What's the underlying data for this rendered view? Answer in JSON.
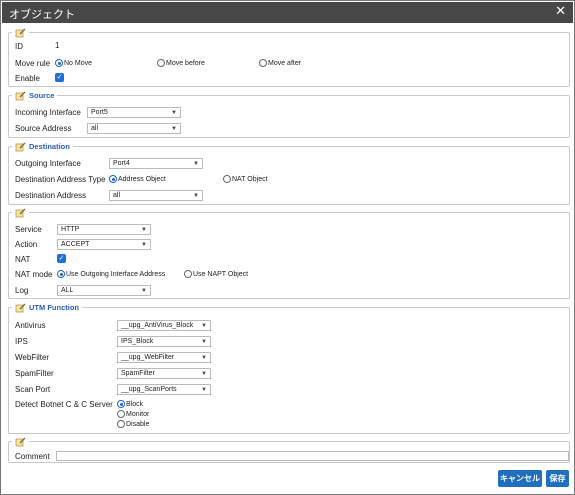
{
  "window": {
    "title": "オブジェクト",
    "close_glyph": "✕"
  },
  "general": {
    "id_label": "ID",
    "id_value": "1",
    "move_rule_label": "Move rule",
    "move_options": [
      "No Move",
      "Move before",
      "Move after"
    ],
    "move_selected": "No Move",
    "enable_label": "Enable",
    "enable_checked": true
  },
  "source": {
    "title": "Source",
    "incoming_interface_label": "Incoming Interface",
    "incoming_interface_value": "Port5",
    "source_address_label": "Source Address",
    "source_address_value": "all"
  },
  "destination": {
    "title": "Destination",
    "outgoing_interface_label": "Outgoing Interface",
    "outgoing_interface_value": "Port4",
    "dest_type_label": "Destination Address Type",
    "dest_type_options": [
      "Address Object",
      "NAT Object"
    ],
    "dest_type_selected": "Address Object",
    "dest_address_label": "Destination Address",
    "dest_address_value": "all"
  },
  "service": {
    "service_label": "Service",
    "service_value": "HTTP",
    "action_label": "Action",
    "action_value": "ACCEPT",
    "nat_label": "NAT",
    "nat_checked": true,
    "nat_mode_label": "NAT mode",
    "nat_mode_options": [
      "Use Outgoing Interface Address",
      "Use NAPT Object"
    ],
    "nat_mode_selected": "Use Outgoing Interface Address",
    "log_label": "Log",
    "log_value": "ALL"
  },
  "utm": {
    "title": "UTM Function",
    "antivirus_label": "Antivirus",
    "antivirus_value": "__upg_AntiVirus_Block",
    "ips_label": "IPS",
    "ips_value": "IPS_Block",
    "webfilter_label": "WebFilter",
    "webfilter_value": "__upg_WebFilter",
    "spamfilter_label": "SpamFilter",
    "spamfilter_value": "SpamFilter",
    "scanport_label": "Scan Port",
    "scanport_value": "__upg_ScanPorts",
    "botnet_label": "Detect Botnet C & C Server",
    "botnet_options": [
      "Block",
      "Monitor",
      "Disable"
    ],
    "botnet_selected": "Block"
  },
  "comment": {
    "label": "Comment",
    "value": ""
  },
  "footer": {
    "cancel_label": "キャンセル",
    "save_label": "保存"
  },
  "colors": {
    "accent": "#1f6fbe",
    "titlebar": "#474747",
    "section_title": "#2a5db0"
  }
}
